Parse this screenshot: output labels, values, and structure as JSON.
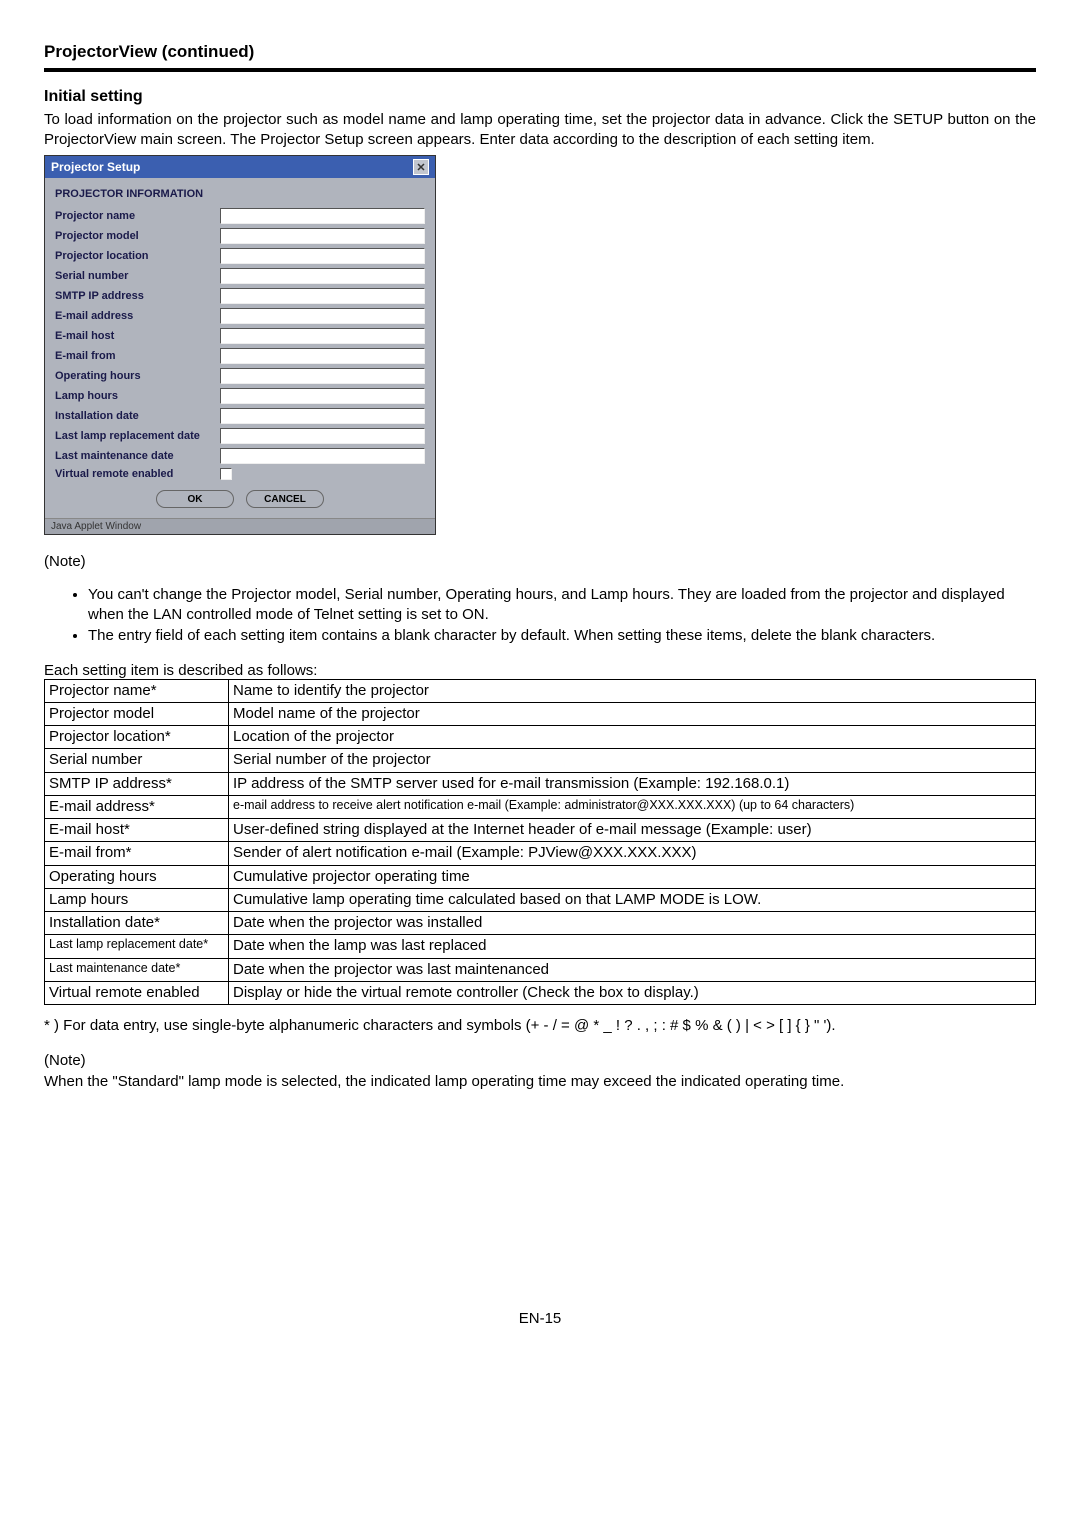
{
  "header": {
    "title": "ProjectorView (continued)"
  },
  "section": {
    "heading": "Initial setting",
    "intro": "To load information on the projector such as model name and lamp operating time, set the projector data in advance. Click the SETUP button on the ProjectorView main screen. The Projector Setup screen appears. Enter data according to the description of each setting item."
  },
  "dialog": {
    "title": "Projector Setup",
    "section_label": "PROJECTOR INFORMATION",
    "fields": [
      {
        "label": "Projector name",
        "type": "text"
      },
      {
        "label": "Projector model",
        "type": "text"
      },
      {
        "label": "Projector location",
        "type": "text"
      },
      {
        "label": "Serial number",
        "type": "text"
      },
      {
        "label": "SMTP IP address",
        "type": "text"
      },
      {
        "label": "E-mail address",
        "type": "text"
      },
      {
        "label": "E-mail host",
        "type": "text"
      },
      {
        "label": "E-mail from",
        "type": "text"
      },
      {
        "label": "Operating hours",
        "type": "text"
      },
      {
        "label": "Lamp hours",
        "type": "text"
      },
      {
        "label": "Installation date",
        "type": "text"
      },
      {
        "label": "Last lamp replacement date",
        "type": "text"
      },
      {
        "label": "Last maintenance date",
        "type": "text"
      },
      {
        "label": "Virtual remote enabled",
        "type": "checkbox"
      }
    ],
    "ok_label": "OK",
    "cancel_label": "CANCEL",
    "footer": "Java Applet Window"
  },
  "note1": {
    "label": "(Note)",
    "items": [
      "You can't change the Projector model, Serial number, Operating hours, and Lamp hours. They are loaded from the projector and displayed when the LAN controlled mode of Telnet setting is set to ON.",
      "The entry field of each setting item contains a blank character by default. When setting these items, delete the blank characters."
    ]
  },
  "settings_intro": "Each setting item is described as follows:",
  "desc_table": {
    "rows": [
      {
        "item": "Projector name*",
        "desc": "Name to identify the projector"
      },
      {
        "item": "Projector model",
        "desc": "Model name of the projector"
      },
      {
        "item": "Projector location*",
        "desc": "Location of the projector"
      },
      {
        "item": "Serial number",
        "desc": "Serial number of the projector"
      },
      {
        "item": "SMTP IP address*",
        "desc": "IP address of the SMTP server used for e-mail transmission (Example: 192.168.0.1)"
      },
      {
        "item": "E-mail address*",
        "desc": "e-mail address to receive alert notification e-mail (Example: administrator@XXX.XXX.XXX) (up to 64 characters)",
        "small_desc": true
      },
      {
        "item": "E-mail host*",
        "desc": "User-defined string displayed at the Internet header of e-mail message (Example: user)"
      },
      {
        "item": "E-mail from*",
        "desc": "Sender of alert notification e-mail (Example: PJView@XXX.XXX.XXX)"
      },
      {
        "item": "Operating hours",
        "desc": "Cumulative projector operating time"
      },
      {
        "item": "Lamp hours",
        "desc": "Cumulative lamp operating time calculated based on that LAMP MODE is LOW."
      },
      {
        "item": "Installation date*",
        "desc": "Date when the projector was installed"
      },
      {
        "item": "Last lamp replacement date*",
        "desc": "Date when the lamp was last replaced",
        "small_item": true
      },
      {
        "item": "Last maintenance date*",
        "desc": "Date when the projector was last maintenanced",
        "small_item": true
      },
      {
        "item": "Virtual remote enabled",
        "desc": "Display or hide the virtual remote controller (Check the box to display.)"
      }
    ]
  },
  "footnote": "* ) For data entry, use single-byte alphanumeric characters and symbols (+ - / = @ * _ ! ? . , ; : # $ % & ( ) | < > [ ] { } \" ').",
  "note2": {
    "label": "(Note)",
    "body": "When the \"Standard\" lamp mode is selected, the indicated lamp operating time may exceed the indicated operating time."
  },
  "page_number": "EN-15"
}
